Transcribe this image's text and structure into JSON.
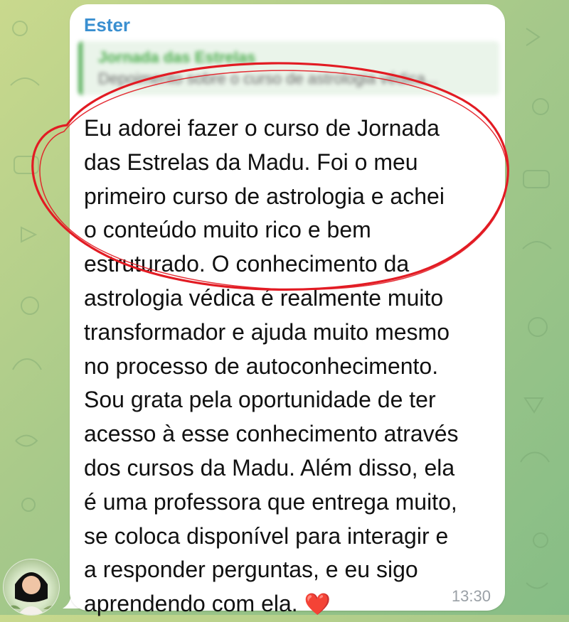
{
  "chat": {
    "sender": "Ester",
    "reply": {
      "title": "Jornada das Estrelas",
      "text": "Depoimento sobre o curso de astrologia védica..."
    },
    "message_lines": [
      "Eu adorei fazer o curso de Jornada",
      "das Estrelas da Madu. Foi o meu",
      "primeiro curso de astrologia e achei",
      "o conteúdo muito rico e bem",
      "estruturado. O conhecimento da",
      "astrologia védica é realmente muito",
      "transformador e ajuda muito mesmo",
      "no processo de autoconhecimento.",
      "Sou grata pela oportunidade de ter",
      "acesso à esse conhecimento através",
      "dos cursos da Madu. Além disso, ela",
      "é uma professora que entrega muito,",
      "se coloca disponível para interagir e",
      "a responder perguntas, e eu sigo",
      "aprendendo com ela."
    ],
    "emoji": "❤️",
    "time": "13:30"
  },
  "colors": {
    "sender": "#3a8fd0",
    "annotation_circle": "#e21b23",
    "heart": "#e1262f",
    "time": "#9aa0a6"
  },
  "icons": {
    "avatar": "sender-avatar",
    "emoji": "red-heart-icon"
  }
}
